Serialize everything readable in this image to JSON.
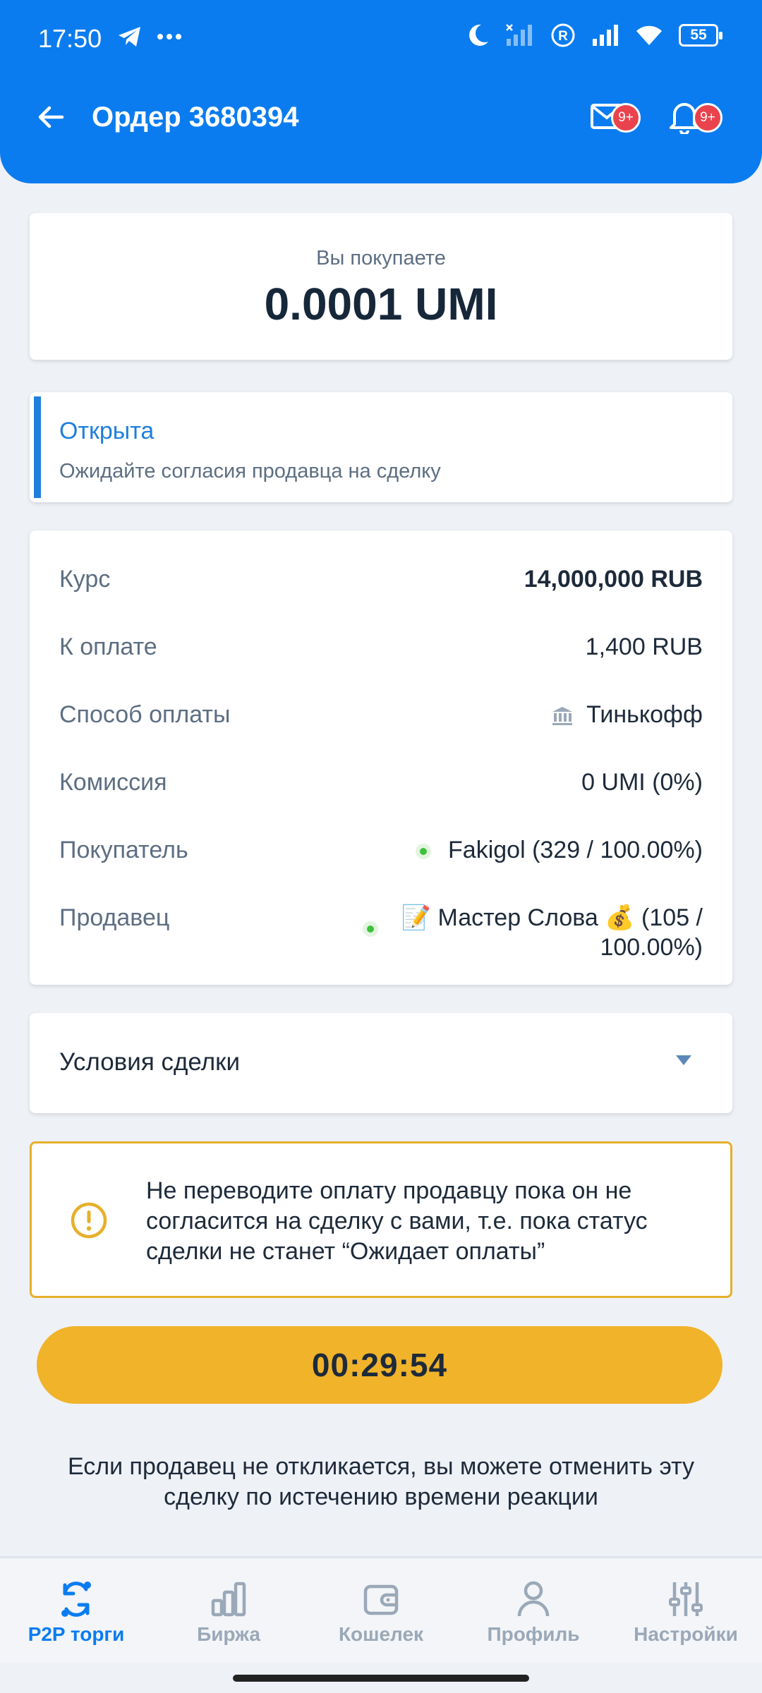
{
  "status_bar": {
    "time": "17:50",
    "battery": "55",
    "icons": [
      "telegram-icon",
      "more-dots-icon",
      "moon-icon",
      "signal-off-icon",
      "roaming-r-icon",
      "signal-icon",
      "wifi-icon",
      "battery-icon"
    ]
  },
  "header": {
    "title": "Ордер 3680394",
    "mail_badge": "9+",
    "bell_badge": "9+"
  },
  "purchase": {
    "label": "Вы покупаете",
    "amount": "0.0001 UMI"
  },
  "order_status": {
    "title": "Открыта",
    "description": "Ожидайте согласия продавца на сделку",
    "accent_color": "#1f7fdc"
  },
  "details": [
    {
      "label": "Курс",
      "value": "14,000,000 RUB"
    },
    {
      "label": "К оплате",
      "value": "1,400 RUB"
    },
    {
      "label": "Способ оплаты",
      "value": "Тинькофф"
    },
    {
      "label": "Комиссия",
      "value": "0 UMI (0%)"
    },
    {
      "label": "Покупатель",
      "value": "Fakigol (329 / 100.00%)"
    },
    {
      "label": "Продавец",
      "value_line1": "📝 Мастер Слова 💰 (105 /",
      "value_line2": "100.00%)"
    }
  ],
  "terms": {
    "label": "Условия сделки"
  },
  "warning": {
    "text": "Не переводите оплату продавцу пока он не согласится на сделку с вами, т.е. пока статус сделки не станет “Ожидает оплаты”",
    "color": "#e6b02a"
  },
  "timer": {
    "value": "00:29:54",
    "color": "#f0b32a"
  },
  "hint": {
    "text": "Если продавец не откликается, вы можете отменить эту сделку по истечению времени реакции"
  },
  "nav": {
    "items": [
      {
        "label": "P2P торги",
        "icon": "p2p-exchange-icon",
        "active": true
      },
      {
        "label": "Биржа",
        "icon": "bar-chart-icon",
        "active": false
      },
      {
        "label": "Кошелек",
        "icon": "wallet-icon",
        "active": false
      },
      {
        "label": "Профиль",
        "icon": "user-icon",
        "active": false
      },
      {
        "label": "Настройки",
        "icon": "sliders-icon",
        "active": false
      }
    ]
  },
  "colors": {
    "brand": "#0a7cf0",
    "background": "#eef1f6"
  }
}
